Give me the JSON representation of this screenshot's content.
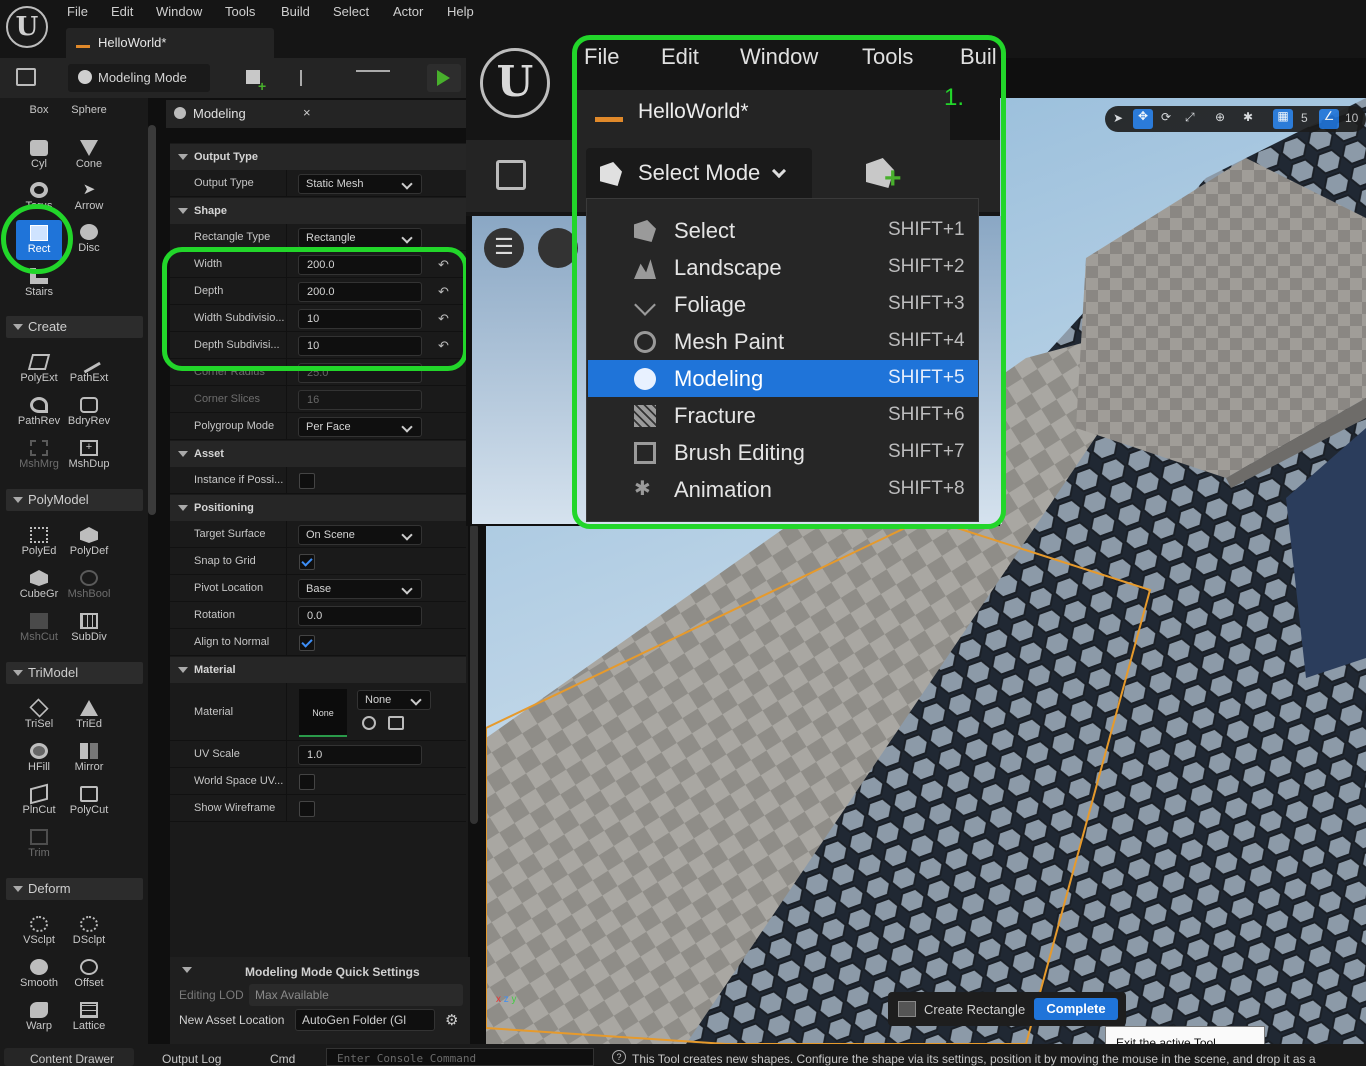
{
  "menubar": [
    "File",
    "Edit",
    "Window",
    "Tools",
    "Build",
    "Select",
    "Actor",
    "Help"
  ],
  "doc_tab": "HelloWorld*",
  "toolbar": {
    "mode_label": "Modeling Mode"
  },
  "palette": {
    "shapes": [
      {
        "label": "Box"
      },
      {
        "label": "Sphere"
      },
      {
        "label": "Cyl"
      },
      {
        "label": "Cone"
      },
      {
        "label": "Torus"
      },
      {
        "label": "Arrow"
      },
      {
        "label": "Rect"
      },
      {
        "label": "Disc"
      },
      {
        "label": "Stairs"
      }
    ],
    "create_header": "Create",
    "create": [
      {
        "label": "PolyExt"
      },
      {
        "label": "PathExt"
      },
      {
        "label": "PathRev"
      },
      {
        "label": "BdryRev"
      },
      {
        "label": "MshMrg"
      },
      {
        "label": "MshDup"
      }
    ],
    "polymodel_header": "PolyModel",
    "polymodel": [
      {
        "label": "PolyEd"
      },
      {
        "label": "PolyDef"
      },
      {
        "label": "CubeGr"
      },
      {
        "label": "MshBool"
      },
      {
        "label": "MshCut"
      },
      {
        "label": "SubDiv"
      }
    ],
    "trimodel_header": "TriModel",
    "trimodel": [
      {
        "label": "TriSel"
      },
      {
        "label": "TriEd"
      },
      {
        "label": "HFill"
      },
      {
        "label": "Mirror"
      },
      {
        "label": "PlnCut"
      },
      {
        "label": "PolyCut"
      },
      {
        "label": "Trim"
      }
    ],
    "deform_header": "Deform",
    "deform": [
      {
        "label": "VSclpt"
      },
      {
        "label": "DSclpt"
      },
      {
        "label": "Smooth"
      },
      {
        "label": "Offset"
      },
      {
        "label": "Warp"
      },
      {
        "label": "Lattice"
      }
    ]
  },
  "panel": {
    "title": "Modeling",
    "cat_output": "Output Type",
    "output_type_label": "Output Type",
    "output_type_value": "Static Mesh",
    "cat_shape": "Shape",
    "rect_type_label": "Rectangle Type",
    "rect_type_value": "Rectangle",
    "width_label": "Width",
    "width_value": "200.0",
    "depth_label": "Depth",
    "depth_value": "200.0",
    "wsub_label": "Width Subdivisio...",
    "wsub_value": "10",
    "dsub_label": "Depth Subdivisi...",
    "dsub_value": "10",
    "corner_radius_label": "Corner Radius",
    "corner_radius_value": "25.0",
    "corner_slices_label": "Corner Slices",
    "corner_slices_value": "16",
    "polygroup_label": "Polygroup Mode",
    "polygroup_value": "Per Face",
    "cat_asset": "Asset",
    "instance_label": "Instance if Possi...",
    "cat_positioning": "Positioning",
    "target_label": "Target Surface",
    "target_value": "On Scene",
    "snap_label": "Snap to Grid",
    "pivot_label": "Pivot Location",
    "pivot_value": "Base",
    "rotation_label": "Rotation",
    "rotation_value": "0.0",
    "align_label": "Align to Normal",
    "cat_material": "Material",
    "material_label": "Material",
    "material_thumb": "None",
    "material_value": "None",
    "uv_label": "UV Scale",
    "uv_value": "1.0",
    "wsuv_label": "World Space UV...",
    "wire_label": "Show Wireframe",
    "quick_title": "Modeling Mode Quick Settings",
    "lod_label": "Editing LOD",
    "lod_value": "Max Available",
    "asset_loc_label": "New Asset Location",
    "asset_loc_value": "AutoGen Folder (Gl"
  },
  "viewport": {
    "grid_value": "5",
    "angle_value": "10",
    "create_rect_label": "Create Rectangle",
    "complete_label": "Complete",
    "tooltip": "Exit the active Tool [Enter]"
  },
  "zoom": {
    "menus": [
      "File",
      "Edit",
      "Window",
      "Tools",
      "Buil"
    ],
    "tab": "HelloWorld*",
    "step": "1.",
    "mode_button": "Select Mode",
    "items": [
      {
        "label": "Select",
        "key": "SHIFT+1"
      },
      {
        "label": "Landscape",
        "key": "SHIFT+2"
      },
      {
        "label": "Foliage",
        "key": "SHIFT+3"
      },
      {
        "label": "Mesh Paint",
        "key": "SHIFT+4"
      },
      {
        "label": "Modeling",
        "key": "SHIFT+5"
      },
      {
        "label": "Fracture",
        "key": "SHIFT+6"
      },
      {
        "label": "Brush Editing",
        "key": "SHIFT+7"
      },
      {
        "label": "Animation",
        "key": "SHIFT+8"
      }
    ]
  },
  "statusbar": {
    "content_drawer": "Content Drawer",
    "output_log": "Output Log",
    "cmd": "Cmd",
    "console_placeholder": "Enter Console Command",
    "hint": "This Tool creates new shapes. Configure the shape via its settings, position it by moving the mouse in the scene, and drop it as a"
  },
  "colors": {
    "accent": "#1f74d9",
    "highlight": "#22d62a",
    "play": "#48b02c",
    "selection_outline": "#e69a2c"
  }
}
